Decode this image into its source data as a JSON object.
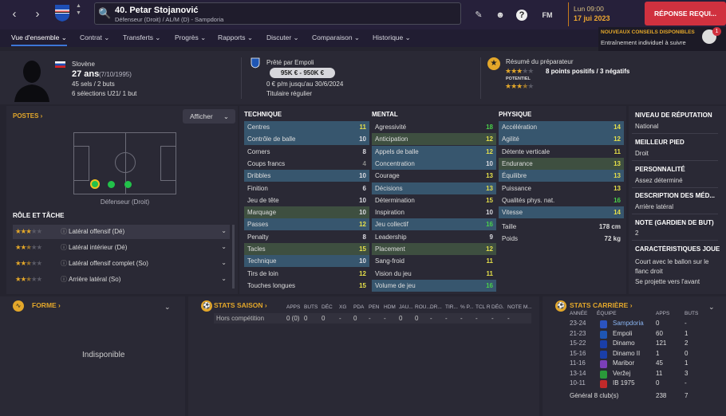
{
  "topbar": {
    "player_name": "40. Petar Stojanović",
    "player_sub": "Défenseur (Droit) / AL/M (D) - Sampdoria",
    "fm_label": "FM",
    "day": "Lun 09:00",
    "date": "17 jui 2023",
    "response_button": "RÉPONSE REQUI..."
  },
  "tabs": [
    {
      "label": "Vue d'ensemble ⌄"
    },
    {
      "label": "Contrat ⌄"
    },
    {
      "label": "Transferts ⌄"
    },
    {
      "label": "Progrès ⌄"
    },
    {
      "label": "Rapports ⌄"
    },
    {
      "label": "Discuter ⌄"
    },
    {
      "label": "Comparaison ⌄"
    },
    {
      "label": "Historique ⌄"
    }
  ],
  "advice": {
    "title": "NOUVEAUX CONSEILS DISPONIBLES",
    "text": "Entraînement individuel à suivre",
    "count": "1"
  },
  "header": {
    "nationality": "Slovène",
    "age": "27 ans",
    "birth": "(7/10/1995)",
    "apps": "45 sels / 2 buts",
    "u21": "6 sélections U21/ 1 but",
    "loan": "Prêté par Empoli",
    "value": "95K € - 950K €",
    "wage": "0 € p/m jusqu'au 30/6/2024",
    "status": "Titulaire régulier",
    "coach_summary": "Résumé du préparateur",
    "current_stars": 3,
    "potential_label": "POTENTIEL",
    "potential_stars": 3.5,
    "points": "8 points positifs / 3 négatifs"
  },
  "positions": {
    "title": "POSTES ›",
    "display_button": "Afficher",
    "label": "Défenseur (Droit)",
    "role_title": "RÔLE ET TÂCHE",
    "roles": [
      {
        "name": "Latéral offensif (Dé)",
        "stars": 3
      },
      {
        "name": "Latéral intérieur (Dé)",
        "stars": 2.5
      },
      {
        "name": "Latéral offensif complet (So)",
        "stars": 2.5
      },
      {
        "name": "Arrière latéral (So)",
        "stars": 2.5
      }
    ]
  },
  "technique": {
    "title": "TECHNIQUE",
    "attrs": [
      {
        "name": "Centres",
        "value": "11",
        "hl": "b"
      },
      {
        "name": "Contrôle de balle",
        "value": "10",
        "hl": "b"
      },
      {
        "name": "Corners",
        "value": "8",
        "hl": ""
      },
      {
        "name": "Coups francs",
        "value": "4",
        "hl": ""
      },
      {
        "name": "Dribbles",
        "value": "10",
        "hl": "b"
      },
      {
        "name": "Finition",
        "value": "6",
        "hl": ""
      },
      {
        "name": "Jeu de tête",
        "value": "10",
        "hl": ""
      },
      {
        "name": "Marquage",
        "value": "10",
        "hl": "g"
      },
      {
        "name": "Passes",
        "value": "12",
        "hl": "b"
      },
      {
        "name": "Penalty",
        "value": "8",
        "hl": ""
      },
      {
        "name": "Tacles",
        "value": "15",
        "hl": "g"
      },
      {
        "name": "Technique",
        "value": "10",
        "hl": "b"
      },
      {
        "name": "Tirs de loin",
        "value": "12",
        "hl": ""
      },
      {
        "name": "Touches longues",
        "value": "15",
        "hl": ""
      }
    ]
  },
  "mental": {
    "title": "MENTAL",
    "attrs": [
      {
        "name": "Agressivité",
        "value": "18",
        "hl": ""
      },
      {
        "name": "Anticipation",
        "value": "12",
        "hl": "g"
      },
      {
        "name": "Appels de balle",
        "value": "12",
        "hl": "b"
      },
      {
        "name": "Concentration",
        "value": "10",
        "hl": "b"
      },
      {
        "name": "Courage",
        "value": "13",
        "hl": ""
      },
      {
        "name": "Décisions",
        "value": "13",
        "hl": "b"
      },
      {
        "name": "Détermination",
        "value": "15",
        "hl": ""
      },
      {
        "name": "Inspiration",
        "value": "10",
        "hl": ""
      },
      {
        "name": "Jeu collectif",
        "value": "16",
        "hl": "b"
      },
      {
        "name": "Leadership",
        "value": "9",
        "hl": ""
      },
      {
        "name": "Placement",
        "value": "12",
        "hl": "g"
      },
      {
        "name": "Sang-froid",
        "value": "11",
        "hl": ""
      },
      {
        "name": "Vision du jeu",
        "value": "11",
        "hl": ""
      },
      {
        "name": "Volume de jeu",
        "value": "16",
        "hl": "b"
      }
    ]
  },
  "physique": {
    "title": "PHYSIQUE",
    "attrs": [
      {
        "name": "Accélération",
        "value": "14",
        "hl": "b"
      },
      {
        "name": "Agilité",
        "value": "12",
        "hl": "b"
      },
      {
        "name": "Détente verticale",
        "value": "11",
        "hl": ""
      },
      {
        "name": "Endurance",
        "value": "13",
        "hl": "g"
      },
      {
        "name": "Équilibre",
        "value": "13",
        "hl": "b"
      },
      {
        "name": "Puissance",
        "value": "13",
        "hl": ""
      },
      {
        "name": "Qualités phys. nat.",
        "value": "16",
        "hl": ""
      },
      {
        "name": "Vitesse",
        "value": "14",
        "hl": "b"
      }
    ],
    "height_label": "Taille",
    "height": "178 cm",
    "weight_label": "Poids",
    "weight": "72 kg"
  },
  "right": {
    "items": [
      {
        "title": "NIVEAU DE RÉPUTATION",
        "value": "National"
      },
      {
        "title": "MEILLEUR PIED",
        "value": "Droit"
      },
      {
        "title": "PERSONNALITÉ",
        "value": "Assez déterminé"
      },
      {
        "title": "DESCRIPTION DES MÉD...",
        "value": "Arrière latéral"
      },
      {
        "title": "NOTE (GARDIEN DE BUT)",
        "value": "2"
      },
      {
        "title": "CARACTÉRISTIQUES JOUE",
        "value": "Court avec le ballon sur le flanc droit"
      }
    ],
    "extra": "Se projette vers l'avant"
  },
  "form": {
    "title": "FORME ›",
    "empty": "Indisponible"
  },
  "season": {
    "title": "STATS SAISON ›",
    "headers": [
      "APPS",
      "BUTS",
      "DÉC",
      "XG",
      "PDA",
      "PEN",
      "HDM",
      "JAU...",
      "ROU...",
      "DR...",
      "TIR...",
      "% P...",
      "TCL R",
      "DÉG.",
      "NOTE M..."
    ],
    "row_label": "Hors compétition",
    "values": [
      "0 (0)",
      "0",
      "0",
      "-",
      "0",
      "-",
      "-",
      "0",
      "0",
      "-",
      "-",
      "-",
      "-",
      "-",
      "-"
    ]
  },
  "career": {
    "title": "STATS CARRIÈRE ›",
    "headers": [
      "ANNÉE",
      "ÉQUIPE",
      "APPS",
      "BUTS"
    ],
    "rows": [
      {
        "year": "23-24",
        "team": "Sampdoria",
        "apps": "0",
        "goals": "-",
        "color": "#2b54c0",
        "link": true
      },
      {
        "year": "21-23",
        "team": "Empoli",
        "apps": "60",
        "goals": "1",
        "color": "#1e56b4",
        "link": false
      },
      {
        "year": "15-22",
        "team": "Dinamo",
        "apps": "121",
        "goals": "2",
        "color": "#1a3fa8",
        "link": false
      },
      {
        "year": "15-16",
        "team": "Dinamo II",
        "apps": "1",
        "goals": "0",
        "color": "#1a3fa8",
        "link": false
      },
      {
        "year": "11-16",
        "team": "Maribor",
        "apps": "45",
        "goals": "1",
        "color": "#7b3fb8",
        "link": false
      },
      {
        "year": "13-14",
        "team": "Veržej",
        "apps": "11",
        "goals": "3",
        "color": "#2a9a3a",
        "link": false
      },
      {
        "year": "10-11",
        "team": "IB 1975",
        "apps": "0",
        "goals": "-",
        "color": "#c02a2a",
        "link": false
      }
    ],
    "total_label": "Général 8 club(s)",
    "total_apps": "238",
    "total_goals": "7"
  }
}
